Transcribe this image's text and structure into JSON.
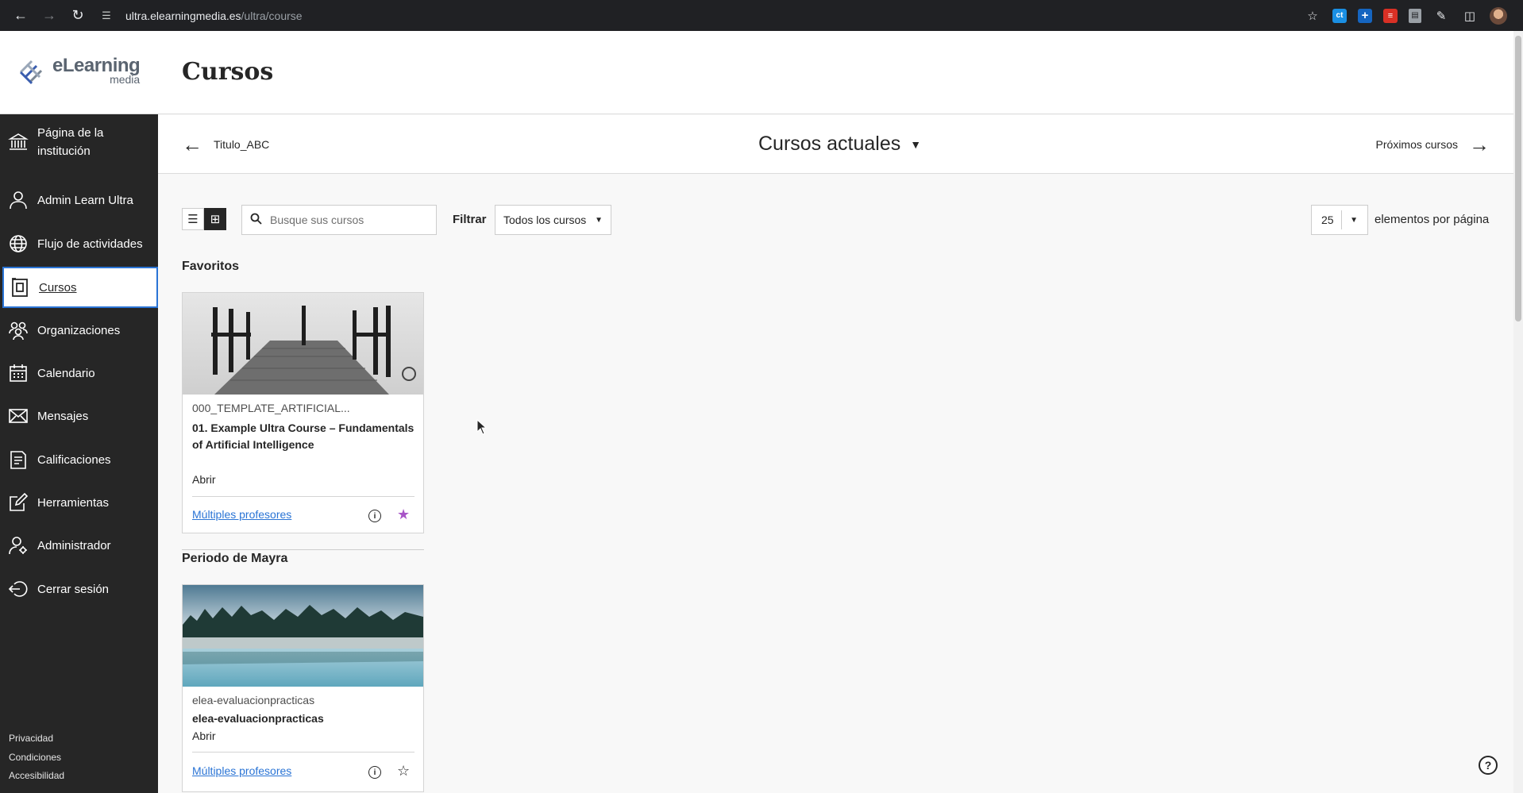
{
  "browser": {
    "url_host": "ultra.elearningmedia.es",
    "url_path": "/ultra/course"
  },
  "logo": {
    "name": "eLearning",
    "sub": "media"
  },
  "page": {
    "title": "Cursos"
  },
  "sidebar": {
    "items": [
      {
        "label": "Página de la institución",
        "icon": "institution-icon"
      },
      {
        "label": "Admin Learn Ultra",
        "icon": "user-icon"
      },
      {
        "label": "Flujo de actividades",
        "icon": "globe-icon"
      },
      {
        "label": "Cursos",
        "icon": "courses-icon",
        "active": true
      },
      {
        "label": "Organizaciones",
        "icon": "organizations-icon"
      },
      {
        "label": "Calendario",
        "icon": "calendar-icon"
      },
      {
        "label": "Mensajes",
        "icon": "mail-icon"
      },
      {
        "label": "Calificaciones",
        "icon": "grades-icon"
      },
      {
        "label": "Herramientas",
        "icon": "tools-icon"
      },
      {
        "label": "Administrador",
        "icon": "admin-icon"
      },
      {
        "label": "Cerrar sesión",
        "icon": "logout-icon"
      }
    ],
    "footer": [
      "Privacidad",
      "Condiciones",
      "Accesibilidad"
    ]
  },
  "term_nav": {
    "previous": "Titulo_ABC",
    "current": "Cursos actuales",
    "next": "Próximos cursos"
  },
  "toolbar": {
    "search_placeholder": "Busque sus cursos",
    "filter_label": "Filtrar",
    "filter_value": "Todos los cursos",
    "per_page_value": "25",
    "per_page_label": "elementos por página"
  },
  "sections": [
    {
      "title": "Favoritos",
      "courses": [
        {
          "code": "000_TEMPLATE_ARTIFICIAL...",
          "name": "01. Example Ultra Course – Fundamentals of Artificial Intelligence",
          "status": "Abrir",
          "instructors": "Múltiples profesores",
          "favorite": true
        }
      ]
    },
    {
      "title": "Periodo de Mayra",
      "courses": [
        {
          "code": "elea-evaluacionpracticas",
          "name": "elea-evaluacionpracticas",
          "status": "Abrir",
          "instructors": "Múltiples profesores",
          "favorite": false
        }
      ]
    }
  ],
  "colors": {
    "sidebar_bg": "#262626",
    "accent": "#2a74d5",
    "favorite_star": "#a855c7"
  }
}
